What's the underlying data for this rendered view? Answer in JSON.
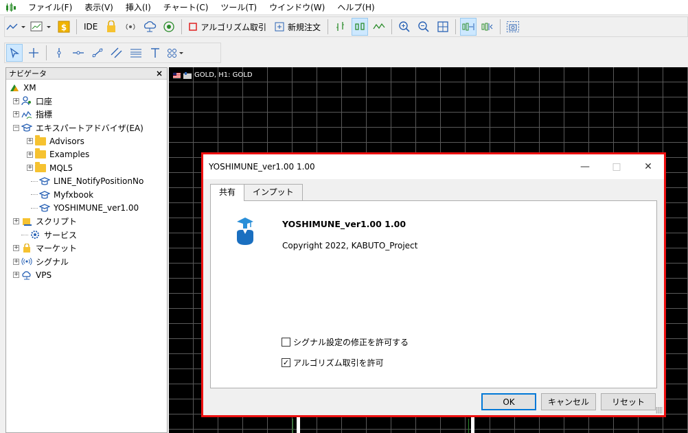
{
  "menubar": {
    "items": [
      "ファイル(F)",
      "表示(V)",
      "挿入(I)",
      "チャート(C)",
      "ツール(T)",
      "ウインドウ(W)",
      "ヘルプ(H)"
    ]
  },
  "toolbar": {
    "ide_label": "IDE",
    "algo_trading_label": "アルゴリズム取引",
    "new_order_label": "新規注文"
  },
  "navigator": {
    "title": "ナビゲータ",
    "close": "×",
    "tree": {
      "root": "XM",
      "accounts": "口座",
      "indicators": "指標",
      "experts": "エキスパートアドバイザ(EA)",
      "advisors": "Advisors",
      "examples": "Examples",
      "mql5": "MQL5",
      "line_notify": "LINE_NotifyPositionNo",
      "myfxbook": "Myfxbook",
      "yoshimune": "YOSHIMUNE_ver1.00",
      "scripts": "スクリプト",
      "services": "サービス",
      "market": "マーケット",
      "signals": "シグナル",
      "vps": "VPS"
    }
  },
  "chart": {
    "title": "GOLD, H1:  GOLD"
  },
  "dialog": {
    "title": "YOSHIMUNE_ver1.00 1.00",
    "minimize": "—",
    "maximize": "□",
    "close": "✕",
    "tabs": [
      "共有",
      "インプット"
    ],
    "ea_name": "YOSHIMUNE_ver1.00 1.00",
    "copyright": "Copyright 2022, KABUTO_Project",
    "allow_signal_label": "シグナル設定の修正を許可する",
    "allow_signal_checked": false,
    "allow_algo_label": "アルゴリズム取引を許可",
    "allow_algo_checked": true,
    "check_mark": "✓",
    "ok": "OK",
    "cancel": "キャンセル",
    "reset": "リセット"
  },
  "colors": {
    "highlight_border": "#e11111",
    "chart_background": "#000000",
    "algo_trading_icon": "#e02020",
    "toolbar_accent": "#2a8c2a"
  }
}
